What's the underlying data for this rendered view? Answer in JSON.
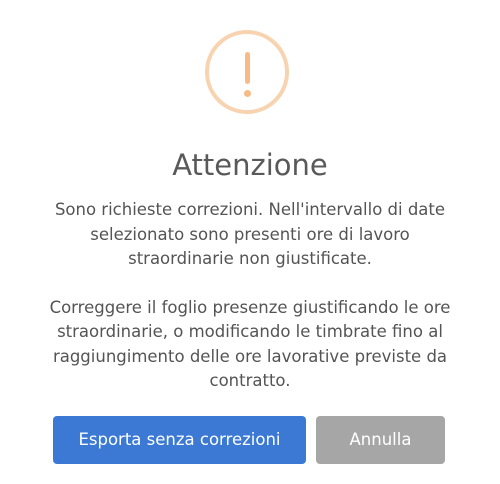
{
  "dialog": {
    "icon": "warning-icon",
    "icon_glyph": "!",
    "title": "Attenzione",
    "message_1_lines": [
      "Sono richieste correzioni. Nell'intervallo di date",
      "selezionato sono presenti ore di lavoro",
      "straordinarie non giustificate."
    ],
    "message_2_lines": [
      "Correggere il foglio presenze giustificando le ore",
      "straordinarie, o modificando le timbrate fino al",
      "raggiungimento delle ore lavorative previste da",
      "contratto."
    ],
    "confirm_label": "Esporta senza correzioni",
    "cancel_label": "Annulla"
  },
  "colors": {
    "confirm": "#3b79d4",
    "cancel": "#a6a6a6",
    "warning_ring": "#f8d3b0",
    "warning_glyph": "#f8bb86",
    "title": "#595959",
    "text": "#545454"
  }
}
